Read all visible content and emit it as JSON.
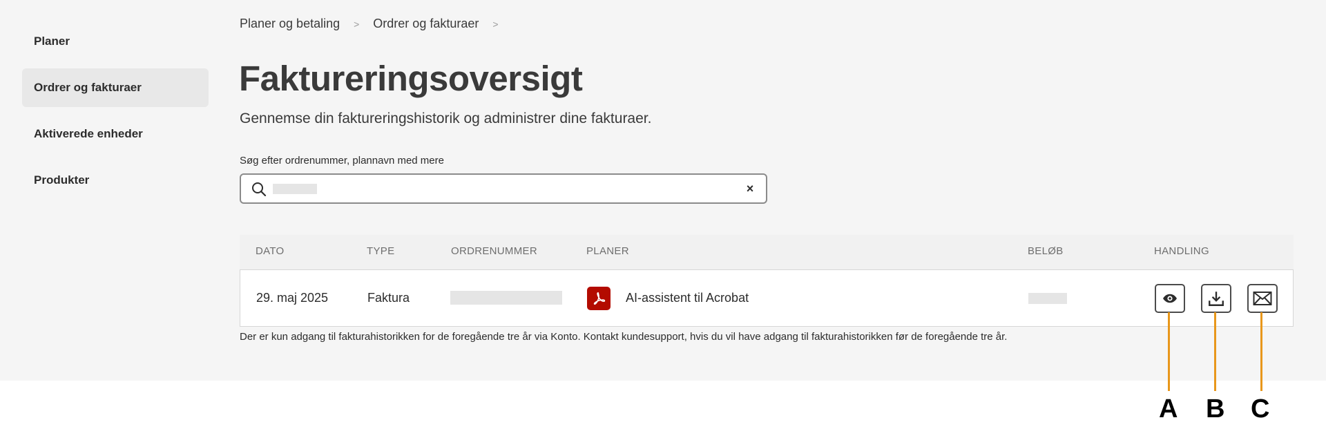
{
  "sidebar": {
    "items": [
      {
        "label": "Planer"
      },
      {
        "label": "Ordrer og fakturaer",
        "active": true
      },
      {
        "label": "Aktiverede enheder"
      },
      {
        "label": "Produkter"
      }
    ]
  },
  "breadcrumb": {
    "items": [
      "Planer og betaling",
      "Ordrer og fakturaer"
    ],
    "separator": ">"
  },
  "page": {
    "title": "Faktureringsoversigt",
    "subtitle": "Gennemse din faktureringshistorik og administrer dine fakturaer."
  },
  "search": {
    "label": "Søg efter ordrenummer, plannavn med mere",
    "value": "",
    "clear_glyph": "×",
    "icon": "search-icon"
  },
  "table": {
    "headers": {
      "date": "DATO",
      "type": "TYPE",
      "order": "ORDRENUMMER",
      "plans": "PLANER",
      "amount": "BELØB",
      "action": "HANDLING"
    },
    "rows": [
      {
        "date": "29. maj 2025",
        "type": "Faktura",
        "order_number": "",
        "plan_icon": "acrobat-pdf-icon",
        "plan": "AI-assistent til Acrobat",
        "amount": "",
        "actions": [
          "view-eye-icon",
          "download-icon",
          "email-icon"
        ]
      }
    ]
  },
  "footnote": "Der er kun adgang til fakturahistorikken for de foregående tre år via Konto. Kontakt kundesupport, hvis du vil have adgang til fakturahistorikken før de foregående tre år.",
  "callouts": [
    "A",
    "B",
    "C"
  ],
  "colors": {
    "background": "#f5f5f5",
    "active_item": "#e8e8e8",
    "acrobat_red": "#b30b00",
    "callout_orange": "#e8971b"
  }
}
